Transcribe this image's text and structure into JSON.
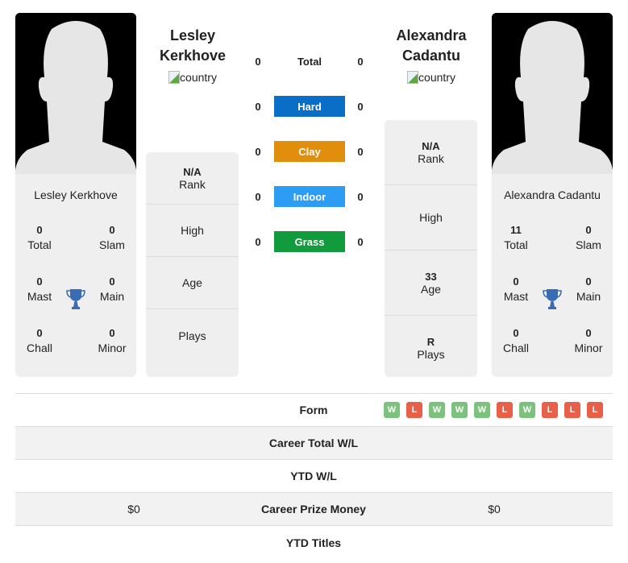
{
  "colors": {
    "hard": "#0a6ec7",
    "clay": "#e08e0b",
    "indoor": "#2d9df3",
    "grass": "#119b3d",
    "win": "#7dc17f",
    "loss": "#e8604a",
    "trophy": "#3a6bb5"
  },
  "player1": {
    "name_line1": "Lesley",
    "name_line2": "Kerkhove",
    "country_alt": "country",
    "card_name": "Lesley Kerkhove",
    "titles": {
      "total": "0",
      "total_label": "Total",
      "slam": "0",
      "slam_label": "Slam",
      "mast": "0",
      "mast_label": "Mast",
      "main": "0",
      "main_label": "Main",
      "chall": "0",
      "chall_label": "Chall",
      "minor": "0",
      "minor_label": "Minor"
    },
    "info": {
      "rank_value": "N/A",
      "rank_label": "Rank",
      "high_value": "",
      "high_label": "High",
      "age_value": "",
      "age_label": "Age",
      "plays_value": "",
      "plays_label": "Plays"
    }
  },
  "player2": {
    "name_line1": "Alexandra",
    "name_line2": "Cadantu",
    "country_alt": "country",
    "card_name": "Alexandra Cadantu",
    "titles": {
      "total": "11",
      "total_label": "Total",
      "slam": "0",
      "slam_label": "Slam",
      "mast": "0",
      "mast_label": "Mast",
      "main": "0",
      "main_label": "Main",
      "chall": "0",
      "chall_label": "Chall",
      "minor": "0",
      "minor_label": "Minor"
    },
    "info": {
      "rank_value": "N/A",
      "rank_label": "Rank",
      "high_value": "",
      "high_label": "High",
      "age_value": "33",
      "age_label": "Age",
      "plays_value": "R",
      "plays_label": "Plays"
    }
  },
  "h2h": [
    {
      "label": "Total",
      "p1": "0",
      "p2": "0"
    },
    {
      "label": "Hard",
      "p1": "0",
      "p2": "0"
    },
    {
      "label": "Clay",
      "p1": "0",
      "p2": "0"
    },
    {
      "label": "Indoor",
      "p1": "0",
      "p2": "0"
    },
    {
      "label": "Grass",
      "p1": "0",
      "p2": "0"
    }
  ],
  "table": {
    "form_label": "Form",
    "form": [
      "W",
      "L",
      "W",
      "W",
      "W",
      "L",
      "W",
      "L",
      "L",
      "L"
    ],
    "career_wl_label": "Career Total W/L",
    "ytd_wl_label": "YTD W/L",
    "prize_label": "Career Prize Money",
    "prize_p1": "$0",
    "prize_p2": "$0",
    "ytd_titles_label": "YTD Titles"
  }
}
